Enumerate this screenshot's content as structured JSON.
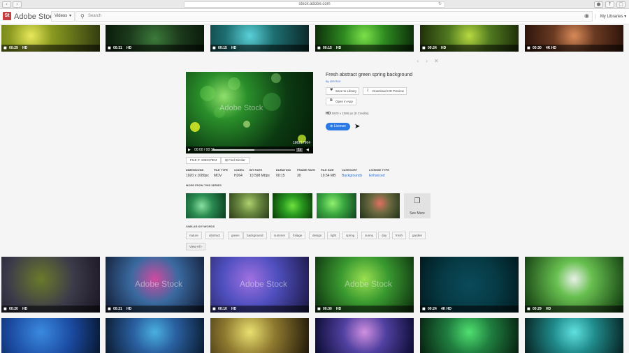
{
  "browser": {
    "url": "stock.adobe.com"
  },
  "header": {
    "logo": "St",
    "brand": "Adobe Stock",
    "category": "Videos",
    "search_placeholder": "Search",
    "libraries": "My Libraries"
  },
  "grid_top": [
    {
      "time": "00:29",
      "badge": "HD"
    },
    {
      "time": "00:31",
      "badge": "HD"
    },
    {
      "time": "00:15",
      "badge": "HD"
    },
    {
      "time": "00:15",
      "badge": "HD"
    },
    {
      "time": "00:24",
      "badge": "HD"
    },
    {
      "time": "00:30",
      "badge": "4K HD"
    }
  ],
  "detail": {
    "title": "Fresh abstract green spring background",
    "by": "By 2097919",
    "save": "Save to Library",
    "download": "Download HD Preview",
    "open": "Open in App",
    "hd": "HD",
    "hd_info": "1920 x 1080 px (8 Credits)",
    "license": "License",
    "video_time": "00:00 / 00:15",
    "watermark": "Adobe Stock",
    "video_id": "186217904",
    "file_id": "FILE #: 186217904",
    "find_similar": "Find Similar",
    "meta": [
      {
        "k": "DIMENSIONS",
        "v": "1920 x 1080px"
      },
      {
        "k": "FILE TYPE",
        "v": "MOV"
      },
      {
        "k": "CODEC",
        "v": "H264"
      },
      {
        "k": "BIT RATE",
        "v": "10.598 Mbps"
      },
      {
        "k": "DURATION",
        "v": "00:15"
      },
      {
        "k": "FRAME RATE",
        "v": "30"
      },
      {
        "k": "FILE SIZE",
        "v": "19.54 MB"
      },
      {
        "k": "CATEGORY",
        "v": "Backgrounds"
      },
      {
        "k": "LICENSE TYPE",
        "v": "Enhanced"
      }
    ],
    "series_label": "MORE FROM THIS SERIES",
    "see_more": "See More",
    "keywords_label": "SIMILAR KEYWORDS",
    "keywords": [
      "nature",
      "abstract",
      "green",
      "background",
      "summer",
      "foliage",
      "design",
      "light",
      "spring",
      "sunny",
      "day",
      "fresh",
      "garden"
    ],
    "view_all": "View All"
  },
  "grid_bottom": [
    {
      "time": "00:20",
      "badge": "HD"
    },
    {
      "time": "00:21",
      "badge": "HD"
    },
    {
      "time": "00:10",
      "badge": "HD"
    },
    {
      "time": "00:30",
      "badge": "HD"
    },
    {
      "time": "00:24",
      "badge": "4K HD"
    },
    {
      "time": "00:29",
      "badge": "HD"
    }
  ],
  "watermark": "Adobe Stock"
}
